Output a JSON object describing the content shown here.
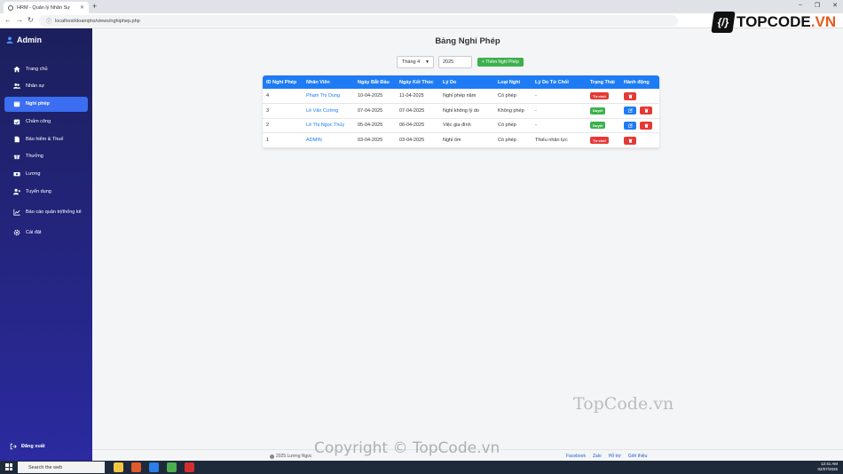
{
  "browser": {
    "tab_title": "HRM - Quản lý Nhân Sự",
    "url": "localhost/doanqlns/views/nghiphep.php"
  },
  "sidebar": {
    "brand": "Admin",
    "items": [
      {
        "label": "Trang chủ",
        "icon": "home-icon"
      },
      {
        "label": "Nhân sự",
        "icon": "users-icon"
      },
      {
        "label": "Nghỉ phép",
        "icon": "calendar-icon",
        "active": true
      },
      {
        "label": "Chấm công",
        "icon": "calendar-check-icon"
      },
      {
        "label": "Bảo hiểm & Thuế",
        "icon": "file-icon"
      },
      {
        "label": "Thưởng",
        "icon": "gift-icon"
      },
      {
        "label": "Lương",
        "icon": "money-icon"
      },
      {
        "label": "Tuyển dụng",
        "icon": "user-plus-icon"
      },
      {
        "label": "Báo cáo quản trị/thống kê",
        "icon": "chart-icon"
      },
      {
        "label": "Cài đặt",
        "icon": "gear-icon"
      }
    ],
    "logout": "Đăng xuất"
  },
  "main": {
    "title": "Bảng Nghỉ Phép",
    "month": "Tháng 4",
    "year": "2025",
    "add_button": "+ Thêm Nghỉ Phép",
    "columns": [
      "ID Nghỉ Phép",
      "Nhân Viên",
      "Ngày Bắt Đầu",
      "Ngày Kết Thúc",
      "Lý Do",
      "Loại Nghỉ",
      "Lý Do Từ Chối",
      "Trạng Thái",
      "Hành động"
    ],
    "rows": [
      {
        "id": "4",
        "employee": "Phạm Thị Dung",
        "start": "10-04-2025",
        "end": "11-04-2025",
        "reason": "Nghỉ phép năm",
        "type": "Có phép",
        "reject_reason": "-",
        "status": "Từ chối",
        "edit": false
      },
      {
        "id": "3",
        "employee": "Lê Văn Cường",
        "start": "07-04-2025",
        "end": "07-04-2025",
        "reason": "Nghỉ không lý do",
        "type": "Không phép",
        "reject_reason": "-",
        "status": "Duyệt",
        "edit": true
      },
      {
        "id": "2",
        "employee": "Lê Thị Ngọc Thủy",
        "start": "05-04-2025",
        "end": "06-04-2025",
        "reason": "Việc gia đình",
        "type": "Có phép",
        "reject_reason": "-",
        "status": "Duyệt",
        "edit": true
      },
      {
        "id": "1",
        "employee": "ADMIN",
        "start": "03-04-2025",
        "end": "03-04-2025",
        "reason": "Nghỉ ốm",
        "type": "Có phép",
        "reject_reason": "Thiếu nhân lực",
        "status": "Từ chối",
        "edit": false
      }
    ]
  },
  "footer": {
    "copyright": "2025 Lương Ngọc",
    "links": [
      "Facebook",
      "Zalo",
      "Hỗ trợ",
      "Giới thiệu"
    ]
  },
  "watermarks": {
    "logo": "TOPCODE.VN",
    "logo_accent": ".VN",
    "logo_main": "TOPCODE",
    "mid": "TopCode.vn",
    "copyright": "Copyright © TopCode.vn"
  },
  "taskbar": {
    "search": "Search the web",
    "time": "12:41 AM",
    "date": "02/07/2025"
  },
  "colors": {
    "sidebar_top": "#1c1f5c",
    "sidebar_bottom": "#2b2aa0",
    "active": "#3b6ef0",
    "header": "#1e7bf5",
    "approved": "#3cb04c",
    "rejected": "#e53935",
    "edit": "#1e7bf5",
    "delete": "#e53935"
  }
}
